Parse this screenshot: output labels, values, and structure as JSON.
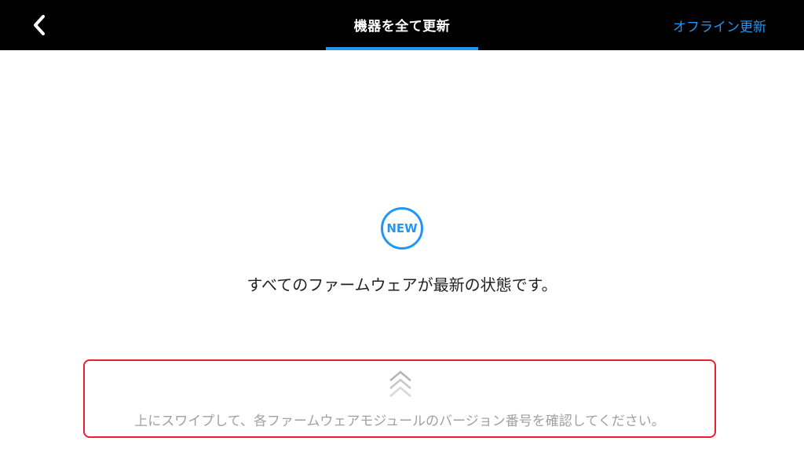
{
  "header": {
    "back_icon": "chevron-left-icon",
    "tab_label": "機器を全て更新",
    "offline_update_label": "オフライン更新",
    "accent_color": "#2196f3"
  },
  "main": {
    "badge_label": "NEW",
    "status_message": "すべてのファームウェアが最新の状態です。"
  },
  "swipe_panel": {
    "icon": "double-chevron-up-icon",
    "hint": "上にスワイプして、各ファームウェアモジュールのバージョン番号を確認してください。",
    "highlight_color": "#e8202f"
  }
}
